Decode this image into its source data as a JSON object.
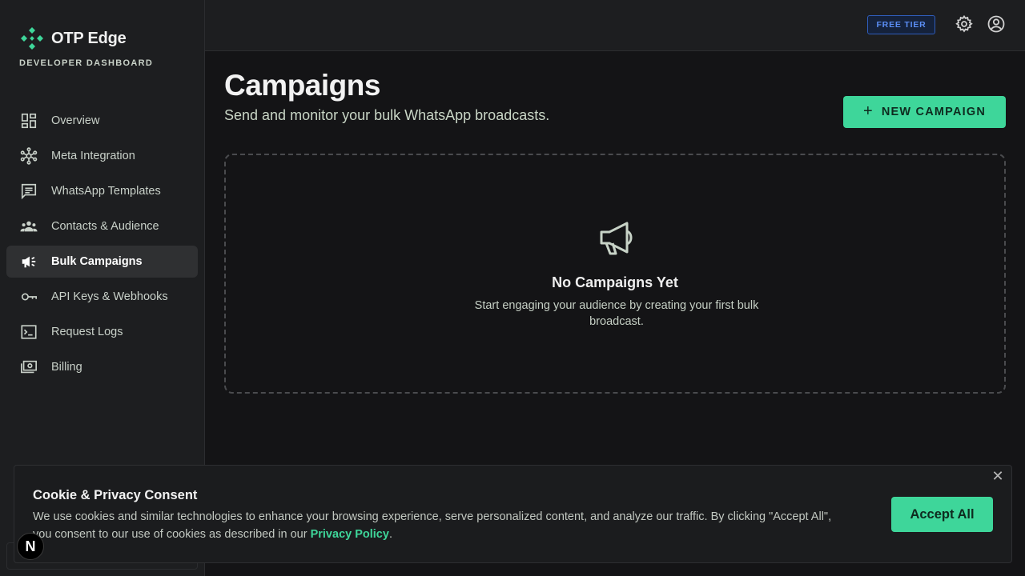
{
  "brand": {
    "name": "OTP Edge",
    "subtitle": "DEVELOPER DASHBOARD",
    "accent": "#3ed69a"
  },
  "sidebar": {
    "items": [
      {
        "label": "Overview",
        "icon": "dashboard-icon",
        "active": false
      },
      {
        "label": "Meta Integration",
        "icon": "hub-icon",
        "active": false
      },
      {
        "label": "WhatsApp Templates",
        "icon": "chat-icon",
        "active": false
      },
      {
        "label": "Contacts & Audience",
        "icon": "group-icon",
        "active": false
      },
      {
        "label": "Bulk Campaigns",
        "icon": "campaign-icon",
        "active": true
      },
      {
        "label": "API Keys & Webhooks",
        "icon": "key-icon",
        "active": false
      },
      {
        "label": "Request Logs",
        "icon": "terminal-icon",
        "active": false
      },
      {
        "label": "Billing",
        "icon": "money-icon",
        "active": false
      }
    ]
  },
  "topbar": {
    "tier_badge": "FREE TIER",
    "settings_icon": "gear-icon",
    "account_icon": "account-circle-icon"
  },
  "main": {
    "title": "Campaigns",
    "subtitle": "Send and monitor your bulk WhatsApp broadcasts.",
    "new_button_icon": "+",
    "new_button_label": "NEW CAMPAIGN",
    "empty_state": {
      "icon": "megaphone-icon",
      "title": "No Campaigns Yet",
      "text": "Start engaging your audience by creating your first bulk broadcast."
    }
  },
  "cookie": {
    "title": "Cookie & Privacy Consent",
    "text_before": "We use cookies and similar technologies to enhance your browsing experience, serve personalized content, and analyze our traffic. By clicking \"Accept All\", you consent to our use of cookies as described in our ",
    "link": "Privacy Policy",
    "text_after": ".",
    "accept_label": "Accept All",
    "close_glyph": "✕"
  },
  "dev_badge": "N"
}
